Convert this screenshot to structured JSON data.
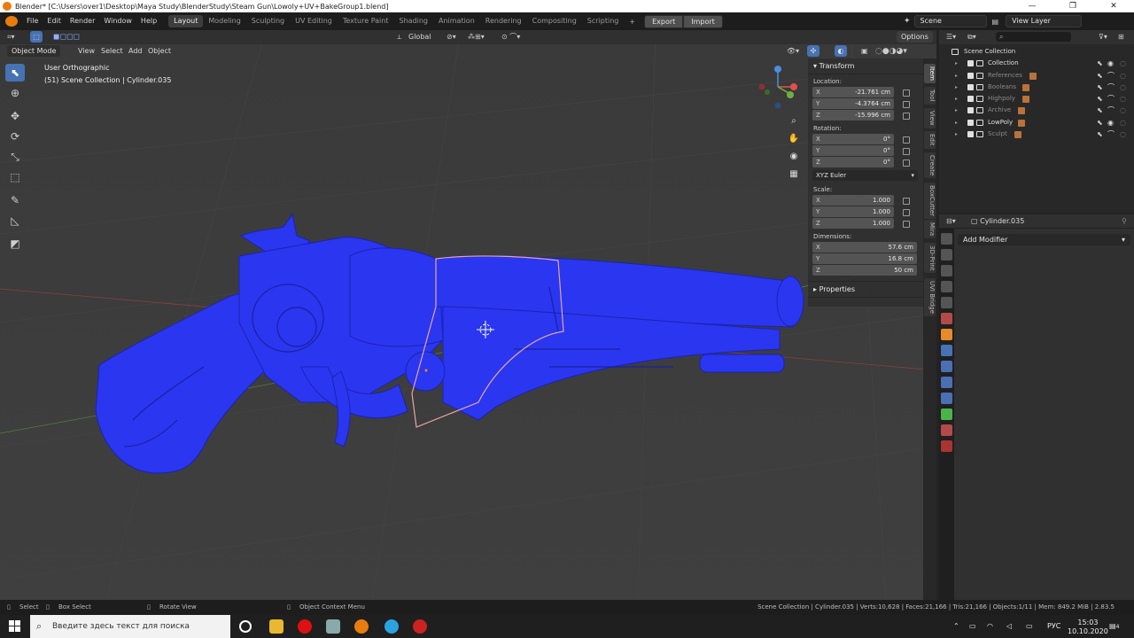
{
  "window": {
    "title": "Blender* [C:\\Users\\over1\\Desktop\\Maya Study\\BlenderStudy\\Steam Gun\\Lowoly+UV+BakeGroup1.blend]"
  },
  "menu": [
    "File",
    "Edit",
    "Render",
    "Window",
    "Help"
  ],
  "workspaces": {
    "tabs": [
      "Layout",
      "Modeling",
      "Sculpting",
      "UV Editing",
      "Texture Paint",
      "Shading",
      "Animation",
      "Rendering",
      "Compositing",
      "Scripting"
    ],
    "active": "Layout",
    "plus": "+"
  },
  "addon_buttons": {
    "export": "Export",
    "import": "Import"
  },
  "scene": {
    "name": "Scene",
    "view_layer": "View Layer"
  },
  "viewport_header": {
    "transform_orientation": "Global",
    "options": "Options",
    "mode": "Object Mode",
    "menus": [
      "View",
      "Select",
      "Add",
      "Object"
    ]
  },
  "viewport": {
    "view_name": "User Orthographic",
    "collection_info": "(51) Scene Collection | Cylinder.035"
  },
  "npanel": {
    "transform_title": "Transform",
    "location_label": "Location:",
    "location": [
      {
        "axis": "X",
        "value": "-21.761 cm"
      },
      {
        "axis": "Y",
        "value": "-4.3764 cm"
      },
      {
        "axis": "Z",
        "value": "-15.996 cm"
      }
    ],
    "rotation_label": "Rotation:",
    "rotation": [
      {
        "axis": "X",
        "value": "0°"
      },
      {
        "axis": "Y",
        "value": "0°"
      },
      {
        "axis": "Z",
        "value": "0°"
      }
    ],
    "rotation_mode": "XYZ Euler",
    "scale_label": "Scale:",
    "scale": [
      {
        "axis": "X",
        "value": "1.000"
      },
      {
        "axis": "Y",
        "value": "1.000"
      },
      {
        "axis": "Z",
        "value": "1.000"
      }
    ],
    "dimensions_label": "Dimensions:",
    "dimensions": [
      {
        "axis": "X",
        "value": "57.6 cm"
      },
      {
        "axis": "Y",
        "value": "16.8 cm"
      },
      {
        "axis": "Z",
        "value": "50 cm"
      }
    ],
    "properties_title": "Properties",
    "side_tabs": [
      "Item",
      "Tool",
      "View",
      "Edit",
      "Create",
      "BoxCutter",
      "Mira",
      "3D-Print",
      "UVI Bridge"
    ]
  },
  "outliner": {
    "root": "Scene Collection",
    "items": [
      {
        "name": "Collection",
        "dim": false,
        "badge": ""
      },
      {
        "name": "References",
        "dim": true,
        "badge": "2"
      },
      {
        "name": "Booleans",
        "dim": true,
        "badge": "3"
      },
      {
        "name": "Highpoly",
        "dim": true,
        "badge": "2"
      },
      {
        "name": "Archive",
        "dim": true,
        "badge": "3"
      },
      {
        "name": "LowPoly",
        "dim": false,
        "badge": "27"
      },
      {
        "name": "Sculpt",
        "dim": true,
        "badge": "2"
      }
    ]
  },
  "properties": {
    "object_name": "Cylinder.035",
    "add_modifier": "Add Modifier"
  },
  "statusbar": {
    "select": "Select",
    "box_select": "Box Select",
    "rotate_view": "Rotate View",
    "context_menu": "Object Context Menu",
    "stats": "Scene Collection | Cylinder.035 | Verts:10,628 | Faces:21,166 | Tris:21,166 | Objects:1/11 | Mem: 849.2 MiB | 2.83.5"
  },
  "taskbar": {
    "search_placeholder": "Введите здесь текст для поиска",
    "lang": "РУС",
    "time": "15:03",
    "date": "10.10.2020",
    "notif_count": "4"
  },
  "colors": {
    "accent": "#4772b3",
    "mesh": "#2a36f0",
    "select_outline": "#e8a4a4",
    "blender_orange": "#e87d0d"
  }
}
